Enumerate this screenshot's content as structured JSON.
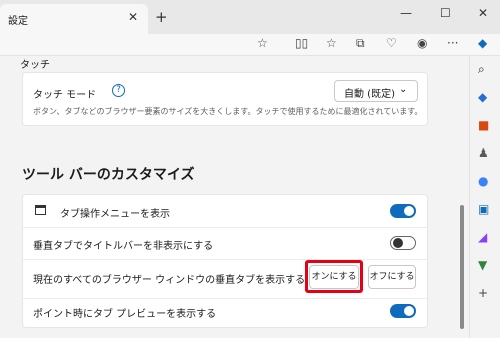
{
  "tab": {
    "title": "設定"
  },
  "touch": {
    "section_title": "タッチ",
    "mode_label": "タッチ モード",
    "mode_desc": "ボタン、タブなどのブラウザー要素のサイズを大きくします。タッチで使用するために最適化されています。",
    "dropdown_value": "自動 (既定)"
  },
  "toolbar_section": {
    "heading": "ツール バーのカスタマイズ",
    "row1": "タブ操作メニューを表示",
    "row2": "垂直タブでタイトルバーを非表示にする",
    "row3": "現在のすべてのブラウザー ウィンドウの垂直タブを表示する",
    "on_button": "オンにする",
    "off_button": "オフにする",
    "row4": "ポイント時にタブ プレビューを表示する"
  }
}
